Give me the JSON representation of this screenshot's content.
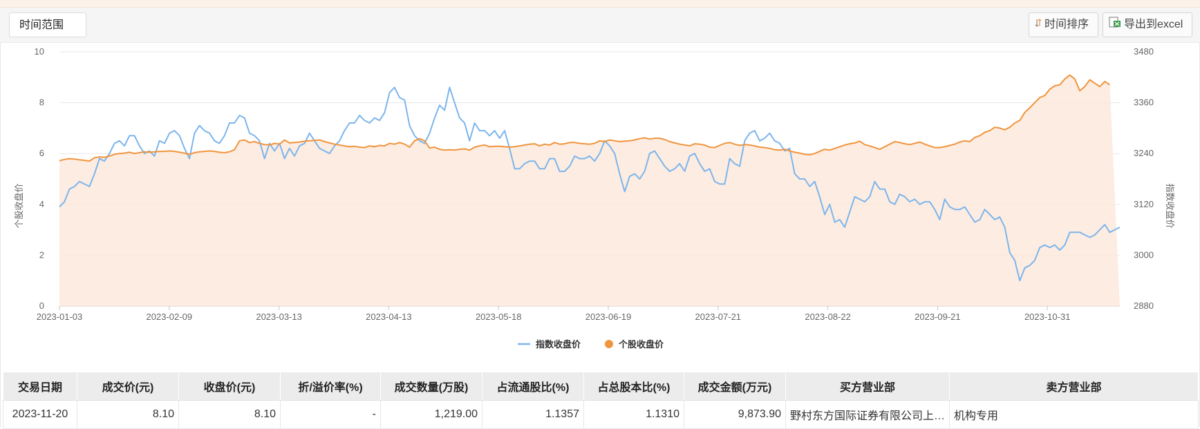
{
  "toolbar": {
    "range_label": "时间范围",
    "sort_label": "时间排序",
    "export_label": "导出到excel"
  },
  "chart_data": {
    "type": "line",
    "ylabel_left": "个股收盘价",
    "ylabel_right": "指数收盘价",
    "ylim_left": [
      0,
      10
    ],
    "ylim_right": [
      2880,
      3480
    ],
    "yticks_left": [
      "0",
      "2",
      "4",
      "6",
      "8",
      "10"
    ],
    "yticks_right": [
      "2880",
      "3000",
      "3120",
      "3240",
      "3360",
      "3480"
    ],
    "x_ticks": [
      "2023-01-03",
      "2023-02-09",
      "2023-03-13",
      "2023-04-13",
      "2023-05-18",
      "2023-06-19",
      "2023-07-21",
      "2023-08-22",
      "2023-09-21",
      "2023-10-31"
    ],
    "grid": true,
    "legend_position": "bottom-center",
    "series": [
      {
        "name": "指数收盘价",
        "axis": "left",
        "color": "#7cb5ec",
        "values": [
          3.9,
          4.1,
          4.6,
          4.7,
          4.9,
          4.8,
          4.7,
          5.2,
          5.8,
          5.7,
          6.0,
          6.4,
          6.5,
          6.3,
          6.7,
          6.7,
          6.3,
          6.0,
          6.1,
          5.9,
          6.5,
          6.4,
          6.8,
          6.9,
          6.7,
          6.2,
          5.8,
          6.8,
          7.1,
          6.9,
          6.8,
          6.5,
          6.4,
          6.7,
          7.2,
          7.2,
          7.5,
          7.4,
          6.8,
          6.7,
          6.5,
          5.8,
          6.4,
          6.1,
          6.4,
          5.8,
          6.2,
          5.9,
          6.3,
          6.4,
          6.8,
          6.5,
          6.2,
          6.1,
          6.0,
          6.3,
          6.5,
          6.9,
          7.2,
          7.2,
          7.5,
          7.3,
          7.2,
          7.4,
          7.3,
          7.6,
          8.4,
          8.6,
          8.2,
          8.1,
          7.1,
          6.7,
          6.5,
          6.4,
          6.8,
          7.4,
          7.9,
          7.7,
          8.6,
          8.0,
          7.4,
          7.2,
          6.5,
          7.2,
          6.9,
          6.9,
          6.7,
          6.9,
          6.6,
          6.9,
          6.2,
          5.4,
          5.4,
          5.6,
          5.7,
          5.7,
          5.4,
          5.4,
          5.8,
          5.8,
          5.3,
          5.3,
          5.5,
          5.9,
          5.8,
          5.8,
          5.9,
          5.7,
          6.0,
          6.5,
          6.3,
          6.0,
          5.2,
          4.5,
          5.1,
          5.2,
          5.0,
          5.3,
          6.0,
          6.1,
          5.8,
          5.5,
          5.3,
          5.4,
          5.6,
          5.3,
          5.9,
          6.0,
          5.6,
          5.3,
          5.4,
          4.9,
          4.8,
          4.8,
          5.8,
          5.6,
          5.5,
          6.5,
          6.8,
          6.9,
          6.5,
          6.6,
          6.8,
          6.5,
          6.4,
          6.1,
          6.2,
          5.2,
          5.0,
          5.0,
          4.7,
          4.9,
          4.3,
          3.6,
          4.0,
          3.3,
          3.4,
          3.1,
          3.7,
          4.3,
          4.2,
          4.1,
          4.3,
          4.9,
          4.6,
          4.6,
          4.1,
          4.0,
          4.4,
          4.3,
          4.1,
          4.2,
          4.0,
          4.1,
          4.1,
          3.8,
          3.4,
          4.2,
          3.9,
          3.8,
          3.8,
          3.9,
          3.6,
          3.3,
          3.4,
          3.8,
          3.6,
          3.4,
          3.5,
          3.1,
          2.1,
          1.8,
          1.0,
          1.5,
          1.6,
          1.8,
          2.3,
          2.4,
          2.3,
          2.4,
          2.2,
          2.4,
          2.9,
          2.9,
          2.9,
          2.8,
          2.7,
          2.8,
          3.0,
          3.2,
          2.9,
          3.0,
          3.1
        ]
      },
      {
        "name": "个股收盘价",
        "axis": "right",
        "color": "#f0943d",
        "values": [
          3223,
          3226,
          3228,
          3227,
          3225,
          3224,
          3222,
          3230,
          3232,
          3231,
          3234,
          3238,
          3240,
          3241,
          3243,
          3240,
          3242,
          3244,
          3243,
          3244,
          3245,
          3245,
          3246,
          3245,
          3243,
          3241,
          3238,
          3242,
          3244,
          3245,
          3246,
          3245,
          3243,
          3242,
          3244,
          3249,
          3270,
          3272,
          3266,
          3268,
          3264,
          3261,
          3260,
          3264,
          3262,
          3272,
          3265,
          3266,
          3267,
          3269,
          3270,
          3271,
          3272,
          3268,
          3265,
          3262,
          3260,
          3258,
          3256,
          3257,
          3255,
          3254,
          3258,
          3256,
          3259,
          3258,
          3264,
          3262,
          3266,
          3262,
          3255,
          3270,
          3275,
          3270,
          3253,
          3255,
          3250,
          3248,
          3249,
          3248,
          3250,
          3251,
          3248,
          3255,
          3258,
          3260,
          3256,
          3257,
          3257,
          3256,
          3255,
          3256,
          3258,
          3260,
          3262,
          3263,
          3258,
          3262,
          3260,
          3266,
          3262,
          3263,
          3266,
          3266,
          3264,
          3263,
          3262,
          3264,
          3270,
          3268,
          3272,
          3270,
          3268,
          3269,
          3270,
          3272,
          3275,
          3277,
          3274,
          3276,
          3276,
          3273,
          3268,
          3265,
          3262,
          3260,
          3258,
          3263,
          3262,
          3260,
          3255,
          3254,
          3259,
          3264,
          3266,
          3262,
          3259,
          3261,
          3260,
          3258,
          3255,
          3254,
          3252,
          3249,
          3248,
          3250,
          3246,
          3243,
          3241,
          3238,
          3237,
          3240,
          3245,
          3250,
          3248,
          3252,
          3256,
          3260,
          3263,
          3265,
          3269,
          3261,
          3258,
          3254,
          3250,
          3256,
          3262,
          3268,
          3266,
          3263,
          3261,
          3264,
          3267,
          3262,
          3258,
          3254,
          3254,
          3256,
          3259,
          3262,
          3267,
          3270,
          3268,
          3278,
          3282,
          3290,
          3294,
          3302,
          3300,
          3296,
          3302,
          3312,
          3318,
          3337,
          3348,
          3360,
          3372,
          3377,
          3392,
          3400,
          3402,
          3416,
          3425,
          3416,
          3388,
          3398,
          3414,
          3406,
          3398,
          3410,
          3402
        ]
      }
    ]
  },
  "legend": {
    "items": [
      "指数收盘价",
      "个股收盘价"
    ]
  },
  "table": {
    "headers": [
      "交易日期",
      "成交价(元)",
      "收盘价(元)",
      "折/溢价率(%)",
      "成交数量(万股)",
      "占流通股比(%)",
      "占总股本比(%)",
      "成交金额(万元)",
      "买方营业部",
      "卖方营业部"
    ],
    "rows": [
      [
        "2023-11-20",
        "8.10",
        "8.10",
        "-",
        "1,219.00",
        "1.1357",
        "1.1310",
        "9,873.90",
        "野村东方国际证券有限公司上…",
        "机构专用"
      ]
    ]
  }
}
